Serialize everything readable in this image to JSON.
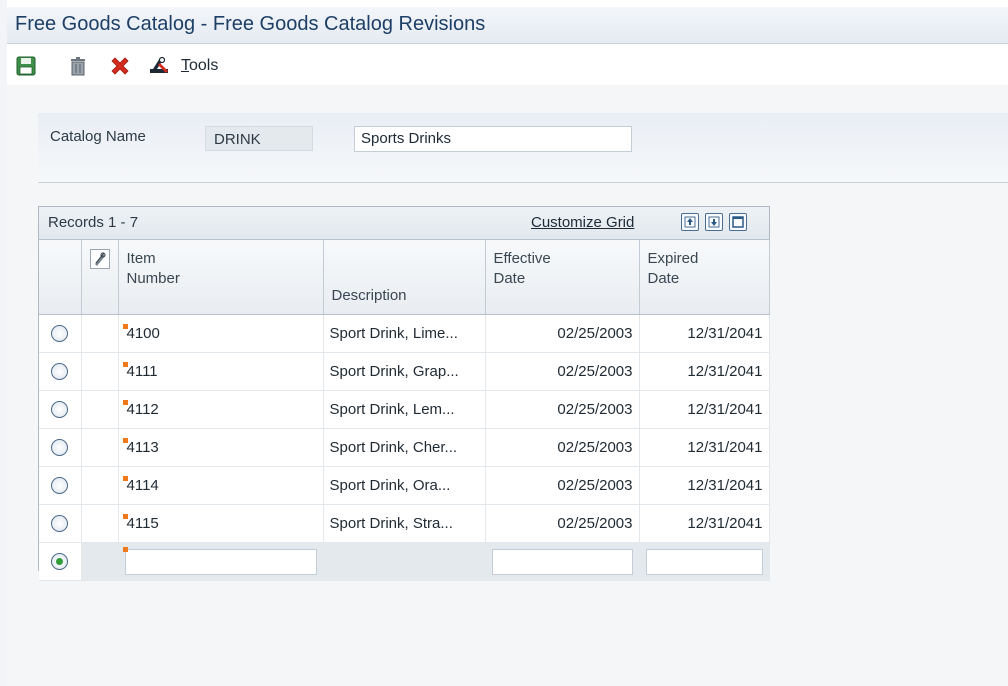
{
  "window": {
    "title": "Free Goods Catalog - Free Goods Catalog Revisions"
  },
  "toolbar": {
    "save_icon": "floppy-disk-icon",
    "delete_icon": "trash-can-icon",
    "cancel_icon": "red-x-icon",
    "tools_icon": "tools-icon",
    "tools_label_first": "T",
    "tools_label_rest": "ools"
  },
  "header": {
    "catalog_label": "Catalog Name",
    "catalog_code": "DRINK",
    "catalog_description": "Sports Drinks"
  },
  "grid": {
    "records_label": "Records 1 - 7",
    "customize_label": "Customize Grid",
    "columns": {
      "item_number": "Item\nNumber",
      "description": "Description",
      "effective_date": "Effective\nDate",
      "expired_date": "Expired\nDate"
    },
    "rows": [
      {
        "item": "4100",
        "description": "Sport Drink, Lime...",
        "effective": "02/25/2003",
        "expired": "12/31/2041"
      },
      {
        "item": "4111",
        "description": "Sport Drink, Grap...",
        "effective": "02/25/2003",
        "expired": "12/31/2041"
      },
      {
        "item": "4112",
        "description": "Sport Drink, Lem...",
        "effective": "02/25/2003",
        "expired": "12/31/2041"
      },
      {
        "item": "4113",
        "description": "Sport Drink, Cher...",
        "effective": "02/25/2003",
        "expired": "12/31/2041"
      },
      {
        "item": "4114",
        "description": "Sport Drink, Ora...",
        "effective": "02/25/2003",
        "expired": "12/31/2041"
      },
      {
        "item": "4115",
        "description": "Sport Drink, Stra...",
        "effective": "02/25/2003",
        "expired": "12/31/2041"
      }
    ],
    "new_row": {
      "item": "",
      "effective": "",
      "expired": ""
    }
  },
  "colors": {
    "title": "#1d3f66",
    "flag": "#f07a1b",
    "radio_selected": "#2f9d38",
    "delete_x": "#d42b1e"
  }
}
